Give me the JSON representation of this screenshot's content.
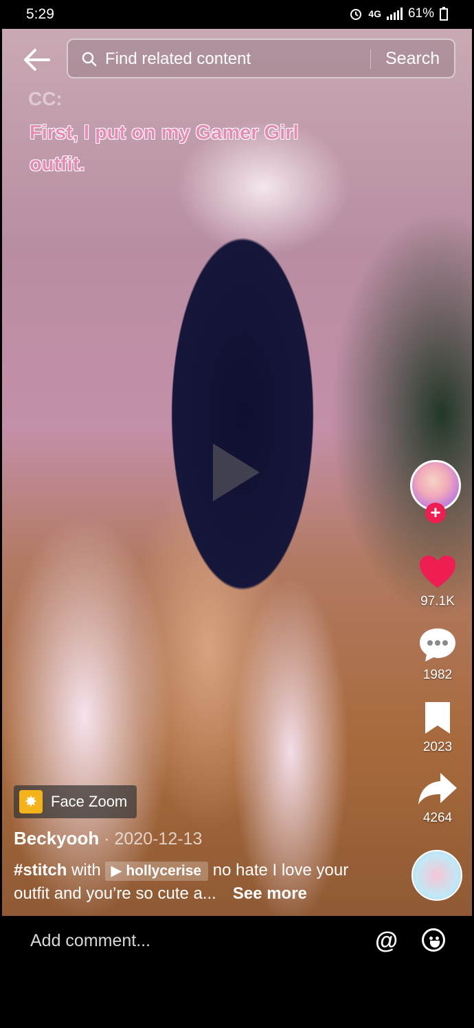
{
  "status_bar": {
    "time": "5:29",
    "network": "4G",
    "battery": "61%"
  },
  "search": {
    "placeholder": "Find related content",
    "button_label": "Search"
  },
  "video": {
    "caption_prefix": "CC:",
    "caption_text": "First, I put on my Gamer Girl outfit."
  },
  "rail": {
    "likes": "97.1K",
    "comments": "1982",
    "saves": "2023",
    "shares": "4264"
  },
  "effect": {
    "label": "Face Zoom"
  },
  "post": {
    "author": "Beckyooh",
    "date": " · 2020-12-13",
    "hashtag": "#stitch",
    "with_text": " with ",
    "mention": "hollycerise",
    "description": " no hate I love your outfit and you’re so cute a...",
    "see_more": "See more"
  },
  "comment_bar": {
    "placeholder": "Add comment..."
  },
  "colors": {
    "like_red": "#ee1d52",
    "caption_pink": "#e58cb4"
  }
}
